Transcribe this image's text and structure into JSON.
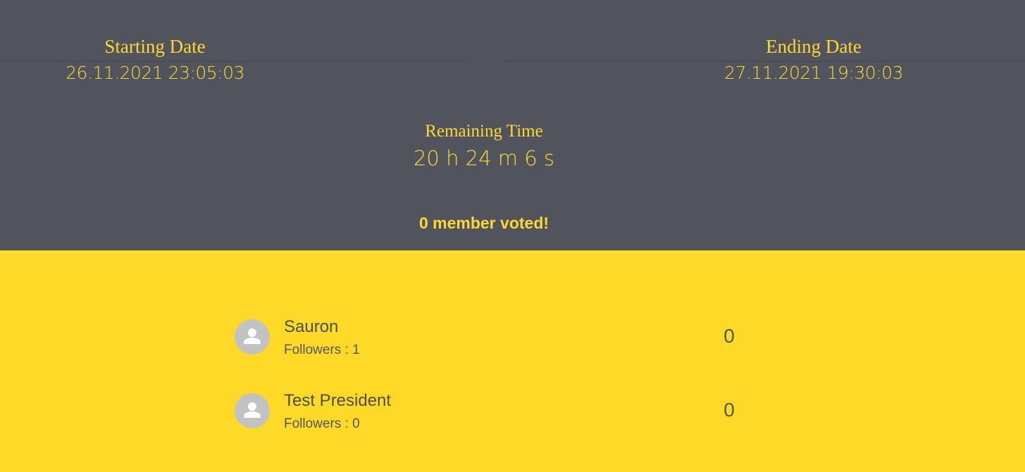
{
  "header": {
    "starting_date_label": "Starting Date",
    "starting_date_value": "26.11.2021 23:05:03",
    "ending_date_label": "Ending Date",
    "ending_date_value": "27.11.2021 19:30:03",
    "remaining_time_label": "Remaining Time",
    "remaining_time_value": "20 h 24 m 6 s",
    "voted_text": "0 member voted!"
  },
  "candidates": [
    {
      "name": "Sauron",
      "followers": "Followers : 1",
      "votes": "0",
      "avatar_icon": "person-icon"
    },
    {
      "name": "Test President",
      "followers": "Followers : 0",
      "votes": "0",
      "avatar_icon": "person-icon"
    }
  ],
  "colors": {
    "header_bg": "#51545c",
    "accent_yellow": "#fdd835",
    "body_bg": "#ffd928",
    "avatar_bg": "#c2c2c2"
  }
}
